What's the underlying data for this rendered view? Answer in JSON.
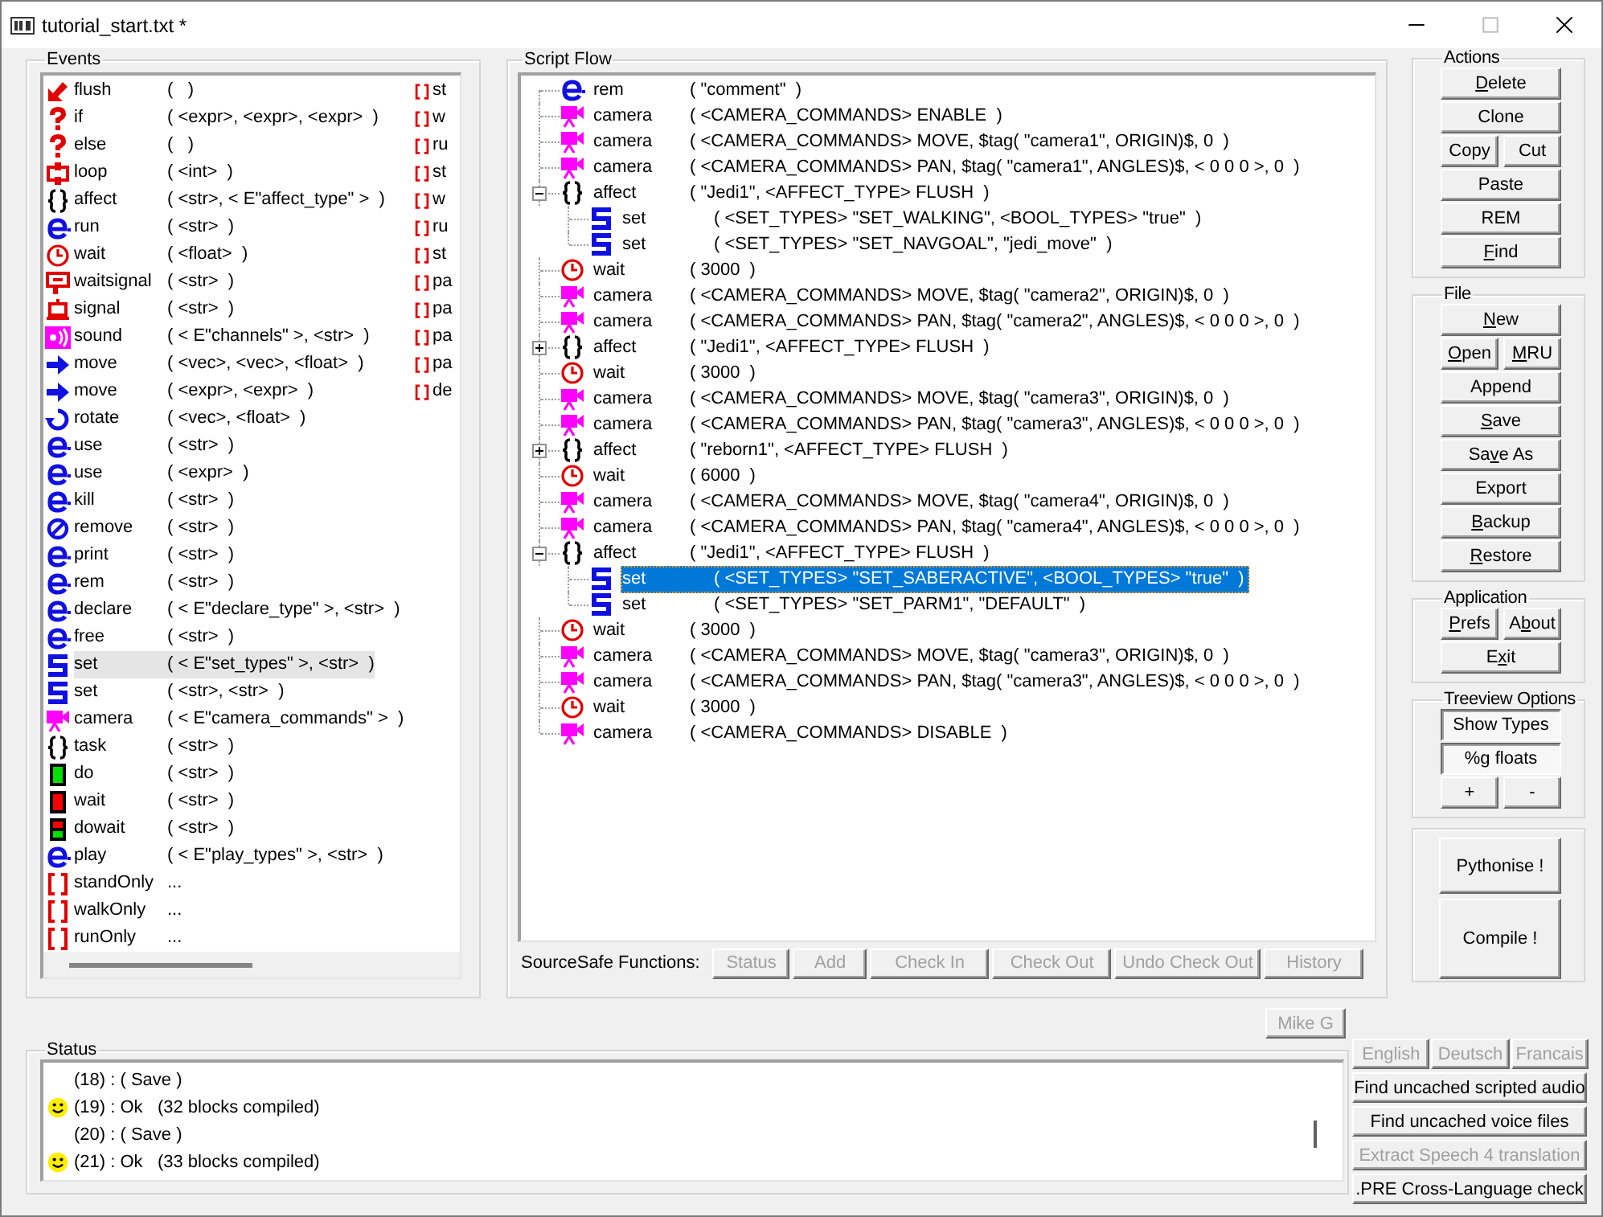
{
  "window": {
    "title": "tutorial_start.txt *"
  },
  "events": {
    "title": "Events",
    "items": [
      {
        "kind": "flush",
        "name": "flush",
        "args": "(   )",
        "selected": false
      },
      {
        "kind": "question",
        "name": "if",
        "args": "( <expr>, <expr>, <expr>  )",
        "selected": false
      },
      {
        "kind": "question",
        "name": "else",
        "args": "(   )",
        "selected": false
      },
      {
        "kind": "loop",
        "name": "loop",
        "args": "( <int>  )",
        "selected": false
      },
      {
        "kind": "braces",
        "name": "affect",
        "args": "( <str>, < E\"affect_type\" >  )",
        "selected": false
      },
      {
        "kind": "e",
        "name": "run",
        "args": "( <str>  )",
        "selected": false
      },
      {
        "kind": "clock",
        "name": "wait",
        "args": "( <float>  )",
        "selected": false
      },
      {
        "kind": "waitsignal",
        "name": "waitsignal",
        "args": "( <str>  )",
        "selected": false
      },
      {
        "kind": "signal",
        "name": "signal",
        "args": "( <str>  )",
        "selected": false
      },
      {
        "kind": "sound",
        "name": "sound",
        "args": "( < E\"channels\" >, <str>  )",
        "selected": false
      },
      {
        "kind": "arrow",
        "name": "move",
        "args": "( <vec>, <vec>, <float>  )",
        "selected": false
      },
      {
        "kind": "arrow",
        "name": "move",
        "args": "( <expr>, <expr>  )",
        "selected": false
      },
      {
        "kind": "rotate",
        "name": "rotate",
        "args": "( <vec>, <float>  )",
        "selected": false
      },
      {
        "kind": "e",
        "name": "use",
        "args": "( <str>  )",
        "selected": false
      },
      {
        "kind": "e",
        "name": "use",
        "args": "( <expr>  )",
        "selected": false
      },
      {
        "kind": "e",
        "name": "kill",
        "args": "( <str>  )",
        "selected": false
      },
      {
        "kind": "remove",
        "name": "remove",
        "args": "( <str>  )",
        "selected": false
      },
      {
        "kind": "e",
        "name": "print",
        "args": "( <str>  )",
        "selected": false
      },
      {
        "kind": "e",
        "name": "rem",
        "args": "( <str>  )",
        "selected": false
      },
      {
        "kind": "e",
        "name": "declare",
        "args": "( < E\"declare_type\" >, <str>  )",
        "selected": false
      },
      {
        "kind": "e",
        "name": "free",
        "args": "( <str>  )",
        "selected": false
      },
      {
        "kind": "set",
        "name": "set",
        "args": "( < E\"set_types\" >, <str>  )",
        "selected": true
      },
      {
        "kind": "set",
        "name": "set",
        "args": "( <str>, <str>  )",
        "selected": false
      },
      {
        "kind": "camera",
        "name": "camera",
        "args": "( < E\"camera_commands\" >  )",
        "selected": false
      },
      {
        "kind": "braces",
        "name": "task",
        "args": "( <str>  )",
        "selected": false
      },
      {
        "kind": "do",
        "name": "do",
        "args": "( <str>  )",
        "selected": false
      },
      {
        "kind": "stop",
        "name": "wait",
        "args": "( <str>  )",
        "selected": false
      },
      {
        "kind": "dowait",
        "name": "dowait",
        "args": "( <str>  )",
        "selected": false
      },
      {
        "kind": "e",
        "name": "play",
        "args": "( < E\"play_types\" >, <str>  )",
        "selected": false
      },
      {
        "kind": "brackets",
        "name": "standOnly",
        "args": "...",
        "selected": false
      },
      {
        "kind": "brackets",
        "name": "walkOnly",
        "args": "...",
        "selected": false
      },
      {
        "kind": "brackets",
        "name": "runOnly",
        "args": "...",
        "selected": false
      },
      {
        "kind": "brackets",
        "name": "st",
        "selected": false
      },
      {
        "kind": "brackets",
        "name": "w",
        "selected": false
      },
      {
        "kind": "brackets",
        "name": "ru",
        "selected": false
      },
      {
        "kind": "brackets",
        "name": "st",
        "selected": false
      },
      {
        "kind": "brackets",
        "name": "w",
        "selected": false
      },
      {
        "kind": "brackets",
        "name": "ru",
        "selected": false
      },
      {
        "kind": "brackets",
        "name": "st",
        "selected": false
      },
      {
        "kind": "brackets",
        "name": "pa",
        "selected": false
      },
      {
        "kind": "brackets",
        "name": "pa",
        "selected": false
      },
      {
        "kind": "brackets",
        "name": "pa",
        "selected": false
      },
      {
        "kind": "brackets",
        "name": "pa",
        "selected": false
      },
      {
        "kind": "brackets",
        "name": "de",
        "selected": false
      }
    ]
  },
  "script_flow": {
    "title": "Script Flow",
    "tree": [
      {
        "kind": "e",
        "name": "rem",
        "args": "( \"comment\"  )",
        "selected": false
      },
      {
        "kind": "camera",
        "name": "camera",
        "args": "( <CAMERA_COMMANDS> ENABLE  )",
        "selected": false
      },
      {
        "kind": "camera",
        "name": "camera",
        "args": "( <CAMERA_COMMANDS> MOVE, $tag( \"camera1\", ORIGIN)$, 0  )",
        "selected": false
      },
      {
        "kind": "camera",
        "name": "camera",
        "args": "( <CAMERA_COMMANDS> PAN, $tag( \"camera1\", ANGLES)$, < 0 0 0 >, 0  )",
        "selected": false
      },
      {
        "kind": "braces",
        "name": "affect",
        "args": "( \"Jedi1\", <AFFECT_TYPE> FLUSH  )",
        "selected": false,
        "expanded": true,
        "children": [
          {
            "kind": "set",
            "name": "set",
            "args": "( <SET_TYPES> \"SET_WALKING\", <BOOL_TYPES> \"true\"  )",
            "selected": false
          },
          {
            "kind": "set",
            "name": "set",
            "args": "( <SET_TYPES> \"SET_NAVGOAL\", \"jedi_move\"  )",
            "selected": false
          }
        ]
      },
      {
        "kind": "clock",
        "name": "wait",
        "args": "( 3000  )",
        "selected": false
      },
      {
        "kind": "camera",
        "name": "camera",
        "args": "( <CAMERA_COMMANDS> MOVE, $tag( \"camera2\", ORIGIN)$, 0  )",
        "selected": false
      },
      {
        "kind": "camera",
        "name": "camera",
        "args": "( <CAMERA_COMMANDS> PAN, $tag( \"camera2\", ANGLES)$, < 0 0 0 >, 0  )",
        "selected": false
      },
      {
        "kind": "braces",
        "name": "affect",
        "args": "( \"Jedi1\", <AFFECT_TYPE> FLUSH  )",
        "selected": false,
        "expanded": false
      },
      {
        "kind": "clock",
        "name": "wait",
        "args": "( 3000  )",
        "selected": false
      },
      {
        "kind": "camera",
        "name": "camera",
        "args": "( <CAMERA_COMMANDS> MOVE, $tag( \"camera3\", ORIGIN)$, 0  )",
        "selected": false
      },
      {
        "kind": "camera",
        "name": "camera",
        "args": "( <CAMERA_COMMANDS> PAN, $tag( \"camera3\", ANGLES)$, < 0 0 0 >, 0  )",
        "selected": false
      },
      {
        "kind": "braces",
        "name": "affect",
        "args": "( \"reborn1\", <AFFECT_TYPE> FLUSH  )",
        "selected": false,
        "expanded": false
      },
      {
        "kind": "clock",
        "name": "wait",
        "args": "( 6000  )",
        "selected": false
      },
      {
        "kind": "camera",
        "name": "camera",
        "args": "( <CAMERA_COMMANDS> MOVE, $tag( \"camera4\", ORIGIN)$, 0  )",
        "selected": false
      },
      {
        "kind": "camera",
        "name": "camera",
        "args": "( <CAMERA_COMMANDS> PAN, $tag( \"camera4\", ANGLES)$, < 0 0 0 >, 0  )",
        "selected": false
      },
      {
        "kind": "braces",
        "name": "affect",
        "args": "( \"Jedi1\", <AFFECT_TYPE> FLUSH  )",
        "selected": false,
        "expanded": true,
        "children": [
          {
            "kind": "set",
            "name": "set",
            "args": "( <SET_TYPES> \"SET_SABERACTIVE\", <BOOL_TYPES> \"true\"  )",
            "selected": true
          },
          {
            "kind": "set",
            "name": "set",
            "args": "( <SET_TYPES> \"SET_PARM1\", \"DEFAULT\"  )",
            "selected": false
          }
        ]
      },
      {
        "kind": "clock",
        "name": "wait",
        "args": "( 3000  )",
        "selected": false
      },
      {
        "kind": "camera",
        "name": "camera",
        "args": "( <CAMERA_COMMANDS> MOVE, $tag( \"camera3\", ORIGIN)$, 0  )",
        "selected": false
      },
      {
        "kind": "camera",
        "name": "camera",
        "args": "( <CAMERA_COMMANDS> PAN, $tag( \"camera3\", ANGLES)$, < 0 0 0 >, 0  )",
        "selected": false
      },
      {
        "kind": "clock",
        "name": "wait",
        "args": "( 3000  )",
        "selected": false
      },
      {
        "kind": "camera",
        "name": "camera",
        "args": "( <CAMERA_COMMANDS> DISABLE  )",
        "selected": false
      }
    ],
    "sourcesafe": {
      "label": "SourceSafe Functions:",
      "buttons": [
        {
          "label": "Status",
          "disabled": true
        },
        {
          "label": "Add",
          "disabled": true
        },
        {
          "label": "Check In",
          "disabled": true
        },
        {
          "label": "Check Out",
          "disabled": true
        },
        {
          "label": "Undo Check Out",
          "disabled": true
        },
        {
          "label": "History",
          "disabled": true
        }
      ]
    }
  },
  "side_groups": [
    {
      "title": "Actions",
      "rows": [
        [
          {
            "key": "D",
            "post": "elete"
          }
        ],
        [
          {
            "label": "Clone"
          }
        ],
        [
          {
            "label": "Copy"
          },
          {
            "label": "Cut"
          }
        ],
        [
          {
            "label": "Paste"
          }
        ],
        [
          {
            "label": "REM"
          }
        ],
        [
          {
            "key": "F",
            "post": "ind"
          }
        ]
      ]
    },
    {
      "title": "File",
      "rows": [
        [
          {
            "key": "N",
            "post": "ew"
          }
        ],
        [
          {
            "key": "O",
            "post": "pen"
          },
          {
            "key": "M",
            "post": "RU"
          }
        ],
        [
          {
            "label": "Append"
          }
        ],
        [
          {
            "key": "S",
            "post": "ave"
          }
        ],
        [
          {
            "pre": "Sa",
            "key": "v",
            "post": "e As"
          }
        ],
        [
          {
            "label": "Export"
          }
        ],
        [
          {
            "key": "B",
            "post": "ackup"
          }
        ],
        [
          {
            "key": "R",
            "post": "estore"
          }
        ]
      ]
    },
    {
      "title": "Application",
      "rows": [
        [
          {
            "key": "P",
            "post": "refs"
          },
          {
            "pre": "A",
            "key": "b",
            "post": "out"
          }
        ],
        [
          {
            "pre": "E",
            "key": "x",
            "post": "it"
          }
        ]
      ]
    },
    {
      "title": "Treeview Options",
      "rows": [
        [
          {
            "label": "Show Types",
            "pressed": true
          }
        ],
        [
          {
            "label": "%g floats",
            "pressed": true
          }
        ],
        [
          {
            "label": "+",
            "pressed": false
          },
          {
            "label": "-",
            "pressed": false
          }
        ]
      ]
    }
  ],
  "build_buttons": [
    {
      "label": "Pythonise !",
      "kind": "medium"
    },
    {
      "label": "Compile !",
      "kind": "large"
    }
  ],
  "author_button": {
    "label": "Mike G",
    "disabled": true
  },
  "status": {
    "title": "Status",
    "lines": [
      {
        "kind": "note",
        "text": "(18) : ( Save )"
      },
      {
        "kind": "ok",
        "text": "(19) : Ok   (32 blocks compiled)"
      },
      {
        "kind": "note",
        "text": "(20) : ( Save )"
      },
      {
        "kind": "ok",
        "text": "(21) : Ok   (33 blocks compiled)"
      }
    ]
  },
  "languages": [
    {
      "label": "English",
      "disabled": true
    },
    {
      "label": "Deutsch",
      "disabled": true
    },
    {
      "label": "Francais",
      "disabled": true
    }
  ],
  "tools": [
    {
      "label": "Find uncached scripted audio",
      "disabled": false
    },
    {
      "label": "Find uncached voice files",
      "disabled": false
    },
    {
      "label": "Extract Speech 4 translation",
      "disabled": true
    },
    {
      "label": ".PRE Cross-Language check",
      "disabled": false
    }
  ]
}
